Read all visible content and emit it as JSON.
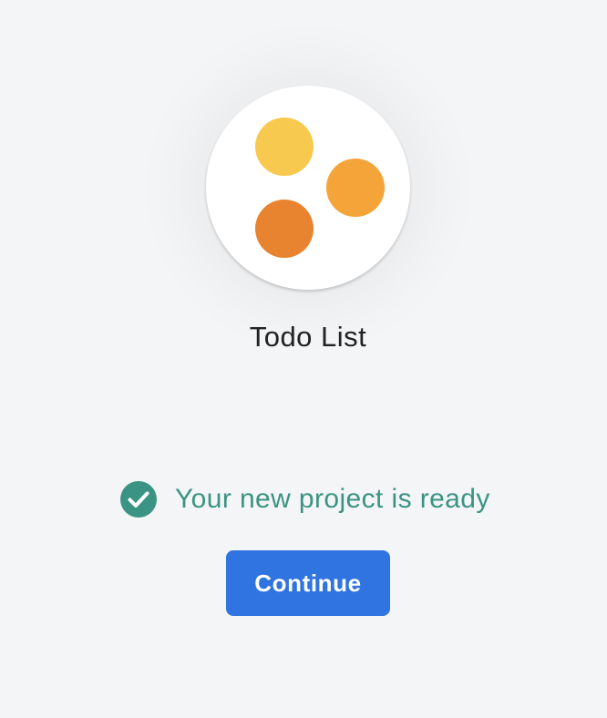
{
  "project": {
    "name": "Todo List",
    "logo_icon": "three-dots-logo-icon",
    "logo_colors": [
      "#f8c94f",
      "#f5a43a",
      "#e88430"
    ]
  },
  "status": {
    "icon": "check-circle-icon",
    "text": "Your new project is ready",
    "color": "#3b9483"
  },
  "actions": {
    "continue_label": "Continue",
    "continue_color": "#2f74e0"
  }
}
